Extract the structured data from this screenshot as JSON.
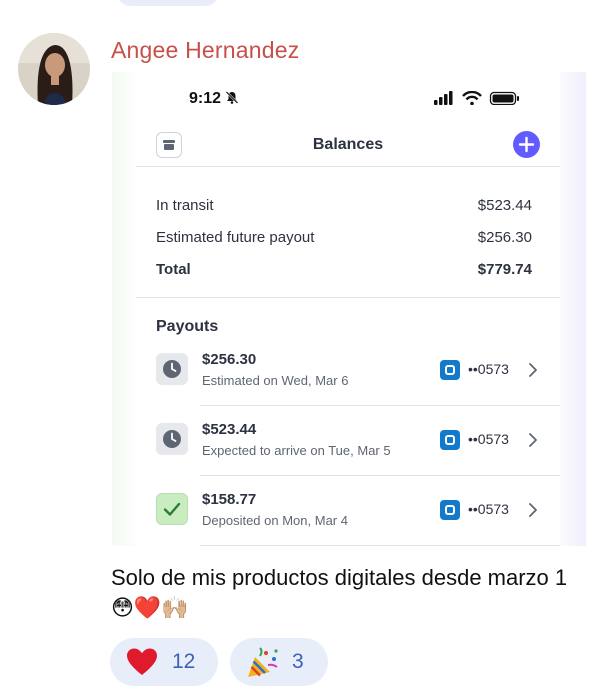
{
  "post": {
    "author": "Angee Hernandez",
    "message": "Solo de mis productos digitales desde marzo 1 😳❤️🙌🏼"
  },
  "phone": {
    "status_time": "9:12",
    "header_title": "Balances",
    "balances": [
      {
        "label": "In transit",
        "value": "$523.44"
      },
      {
        "label": "Estimated future payout",
        "value": "$256.30"
      },
      {
        "label": "Total",
        "value": "$779.74"
      }
    ],
    "payouts_title": "Payouts",
    "payouts": [
      {
        "amount": "$256.30",
        "desc": "Estimated on Wed, Mar 6",
        "account": "••0573",
        "status_icon": "clock-icon"
      },
      {
        "amount": "$523.44",
        "desc": "Expected to arrive on Tue, Mar 5",
        "account": "••0573",
        "status_icon": "clock-icon"
      },
      {
        "amount": "$158.77",
        "desc": "Deposited on Mon, Mar 4",
        "account": "••0573",
        "status_icon": "check-icon"
      }
    ]
  },
  "reactions": [
    {
      "emoji": "heart",
      "count": "12"
    },
    {
      "emoji": "party-popper",
      "count": "3"
    }
  ],
  "colors": {
    "author": "#c7504a",
    "accent": "#635bff",
    "bank": "#117acd",
    "reaction_bg": "#e8eef9",
    "reaction_count": "#3c62b8"
  }
}
